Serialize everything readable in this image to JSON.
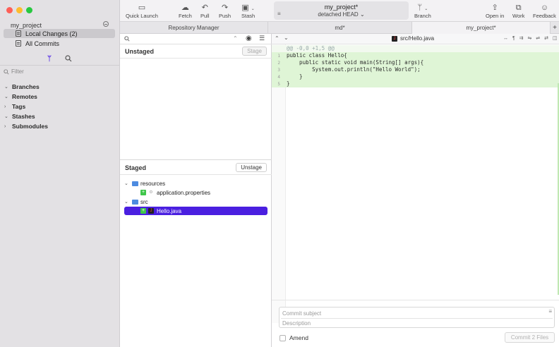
{
  "sidebar": {
    "project": "my_project",
    "items": [
      {
        "label": "Local Changes (2)"
      },
      {
        "label": "All Commits"
      }
    ],
    "filter_placeholder": "Filter",
    "sections": [
      "Branches",
      "Remotes",
      "Tags",
      "Stashes",
      "Submodules"
    ]
  },
  "toolbar": {
    "quick_launch": "Quick Launch",
    "fetch": "Fetch",
    "pull": "Pull",
    "push": "Push",
    "stash": "Stash",
    "repo_name": "my_project*",
    "head_state": "detached HEAD",
    "branch": "Branch",
    "open_in": "Open in",
    "work": "Work",
    "feedback": "Feedback"
  },
  "tabs": [
    {
      "label": "Repository Manager"
    },
    {
      "label": "md*"
    },
    {
      "label": "my_project*"
    },
    {
      "label": "+"
    }
  ],
  "changes": {
    "unstaged_title": "Unstaged",
    "stage_button": "Stage",
    "staged_title": "Staged",
    "unstage_button": "Unstage",
    "tree": {
      "folder1": "resources",
      "file1": "application.properties",
      "folder2": "src",
      "file2": "Hello.java"
    }
  },
  "editor": {
    "file_path": "src/Hello.java",
    "hunk": "@@ -0,0 +1,5 @@",
    "lines": [
      {
        "n": "1",
        "text": "public class Hello{"
      },
      {
        "n": "2",
        "text": "    public static void main(String[] args){"
      },
      {
        "n": "3",
        "text": "        System.out.println(\"Hello World\");"
      },
      {
        "n": "4",
        "text": "    }"
      },
      {
        "n": "5",
        "text": "}"
      }
    ]
  },
  "commit": {
    "subject_placeholder": "Commit subject",
    "description_placeholder": "Description",
    "amend_label": "Amend",
    "commit_button": "Commit 2 Files"
  },
  "colors": {
    "selection": "#4a1fe0",
    "added_line": "#dff5d6",
    "folder": "#4d8be0",
    "added_badge": "#3fc64a"
  }
}
